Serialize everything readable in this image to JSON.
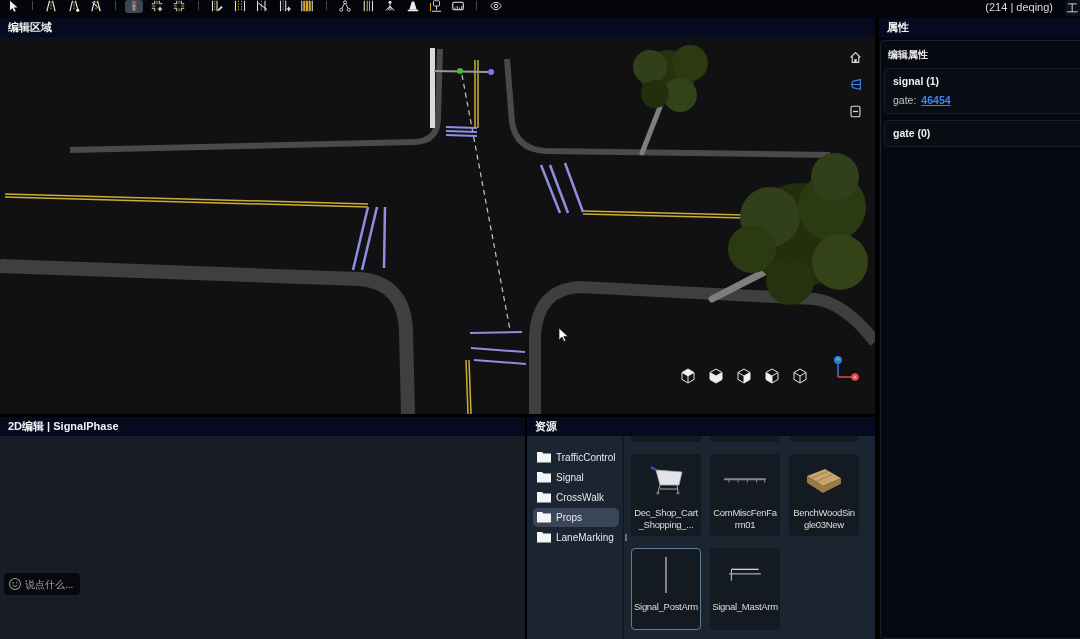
{
  "toolbar": {
    "tool_groups": [
      [
        {
          "kind": "pointer",
          "selected": false
        }
      ],
      [
        {
          "kind": "road",
          "selected": false
        },
        {
          "kind": "road-point",
          "selected": false
        },
        {
          "kind": "road-cut",
          "selected": false
        }
      ],
      [
        {
          "kind": "traffic-light",
          "selected": true
        },
        {
          "kind": "junction-add",
          "selected": false
        },
        {
          "kind": "junction",
          "selected": false
        }
      ],
      [
        {
          "kind": "lane-edit",
          "selected": false
        },
        {
          "kind": "lane",
          "selected": false
        },
        {
          "kind": "lane-cut",
          "selected": false
        },
        {
          "kind": "lane-add",
          "selected": false
        },
        {
          "kind": "double-lane",
          "selected": false
        }
      ],
      [
        {
          "kind": "node-graph",
          "selected": false
        },
        {
          "kind": "lane-marking",
          "selected": false
        },
        {
          "kind": "spray",
          "selected": false
        },
        {
          "kind": "cone",
          "selected": false
        },
        {
          "kind": "sign-post",
          "selected": false
        },
        {
          "kind": "ruler",
          "selected": false
        }
      ],
      [
        {
          "kind": "eye",
          "selected": false
        }
      ]
    ],
    "status": "(214 | deqing)",
    "menu_button": "工"
  },
  "editor": {
    "title": "编辑区域",
    "view_controls": [
      {
        "kind": "home",
        "selected": false
      },
      {
        "kind": "perspective",
        "selected": true
      },
      {
        "kind": "collapse",
        "selected": false
      }
    ],
    "view_cubes": [
      {
        "kind": "top"
      },
      {
        "kind": "front"
      },
      {
        "kind": "right"
      },
      {
        "kind": "left"
      },
      {
        "kind": "back"
      }
    ]
  },
  "panel_2d": {
    "title": "2D编辑 | SignalPhase",
    "chat": {
      "placeholder": "说点什么..."
    }
  },
  "resources": {
    "title": "资源",
    "folders": [
      {
        "label": "TrafficControl",
        "selected": false
      },
      {
        "label": "Signal",
        "selected": false
      },
      {
        "label": "CrossWalk",
        "selected": false
      },
      {
        "label": "Props",
        "selected": true
      },
      {
        "label": "LaneMarking",
        "selected": false
      }
    ],
    "assets": [
      {
        "kind": "cut",
        "selected": false
      },
      {
        "kind": "cut",
        "selected": false
      },
      {
        "kind": "cut",
        "selected": false
      },
      {
        "kind": "cart",
        "label": "Dec_Shop_Cart_Shopping_...",
        "selected": false
      },
      {
        "kind": "fence",
        "label": "ComMiscFenFarm01",
        "selected": false
      },
      {
        "kind": "bench",
        "label": "BenchWoodSingle03New",
        "selected": false
      },
      {
        "kind": "post-arm",
        "label": "Signal_PostArm",
        "selected": true
      },
      {
        "kind": "mast-arm",
        "label": "Signal_MastArm",
        "selected": false
      }
    ]
  },
  "properties": {
    "title": "属性",
    "section_title": "编辑属性",
    "groups": [
      {
        "title": "signal (1)",
        "fields": [
          {
            "label": "gate:",
            "value": "46454"
          }
        ]
      },
      {
        "title": "gate (0)"
      }
    ]
  }
}
